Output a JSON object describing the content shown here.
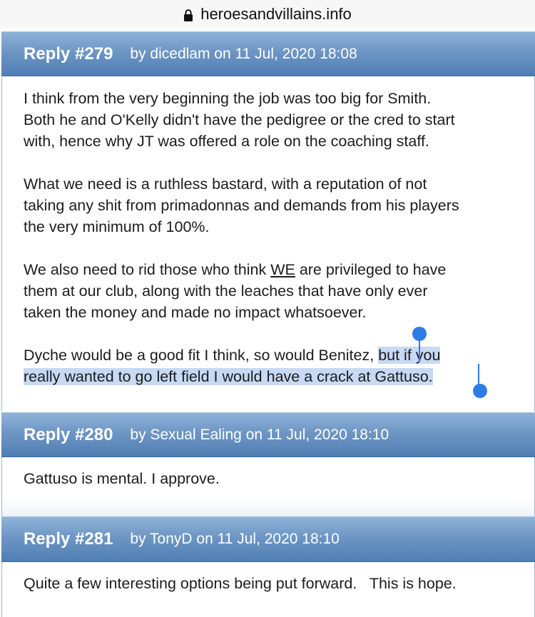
{
  "browser": {
    "domain": "heroesandvillains.info",
    "lock_icon": "lock-icon"
  },
  "posts": [
    {
      "reply_no": "Reply #279",
      "meta": "by dicedlam on 11 Jul, 2020 18:08",
      "paragraphs": [
        {
          "lines": [
            "I think from the very beginning the job was too big for Smith.",
            "Both he and O'Kelly didn't have the pedigree or the cred to start",
            "with, hence why JT was offered a role on the coaching staff."
          ]
        },
        {
          "lines": [
            "What we need is a ruthless bastard, with a reputation of not",
            "taking any shit from primadonnas and demands from his players",
            "the very minimum of 100%."
          ]
        },
        {
          "line1_before": "We also need to rid those who think ",
          "line1_underlined": "WE",
          "line1_after": " are privileged to have",
          "lines": [
            "them at our club, along with the leaches that have only ever",
            "taken the money and made no impact whatsoever."
          ]
        },
        {
          "line1_plain": "Dyche would be a good fit I think, so would Benitez, ",
          "line1_selected": "but if you",
          "line2_selected": "really wanted to go left field I would have a crack at Gattuso."
        }
      ]
    },
    {
      "reply_no": "Reply #280",
      "meta": "by Sexual Ealing on 11 Jul, 2020 18:10",
      "text": "Gattuso is mental. I approve."
    },
    {
      "reply_no": "Reply #281",
      "meta": "by TonyD on 11 Jul, 2020 18:10",
      "text": "Quite a few interesting options being put forward.   This is hope."
    }
  ],
  "selection_color": "#c7d9f3",
  "handle_color": "#2f7be6",
  "header_color": "#6e96c4"
}
